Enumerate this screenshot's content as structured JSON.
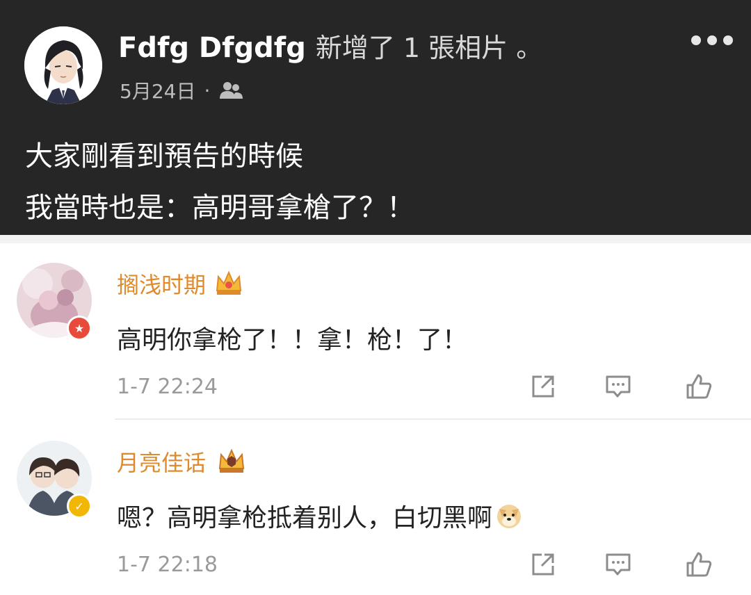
{
  "post": {
    "author": "Fdfg Dfgdfg",
    "action": "新增了 1 張相片 。",
    "date": "5月24日",
    "separator": "·",
    "audience_icon": "friends-icon",
    "more_icon": "more-horizontal-icon",
    "lines": [
      "大家剛看到預告的時候",
      "我當時也是：高明哥拿槍了？！"
    ]
  },
  "comments": [
    {
      "username": "搁浅时期",
      "text": "高明你拿枪了！！拿！枪！了！",
      "time": "1-7 22:24",
      "badge_icon": "red-star-badge-icon",
      "level_icon": "crown-icon"
    },
    {
      "username": "月亮佳话",
      "text": "嗯？高明拿枪抵着别人，白切黑啊",
      "emoji": "doge-emoji-icon",
      "time": "1-7 22:18",
      "badge_icon": "verified-badge-icon",
      "level_icon": "crown-icon"
    }
  ],
  "actions": [
    "share-icon",
    "comment-icon",
    "like-icon"
  ],
  "colors": {
    "post_bg": "#262626",
    "username": "#e08a2e",
    "timestamp": "#9a9a9a",
    "comment_text": "#222222"
  }
}
